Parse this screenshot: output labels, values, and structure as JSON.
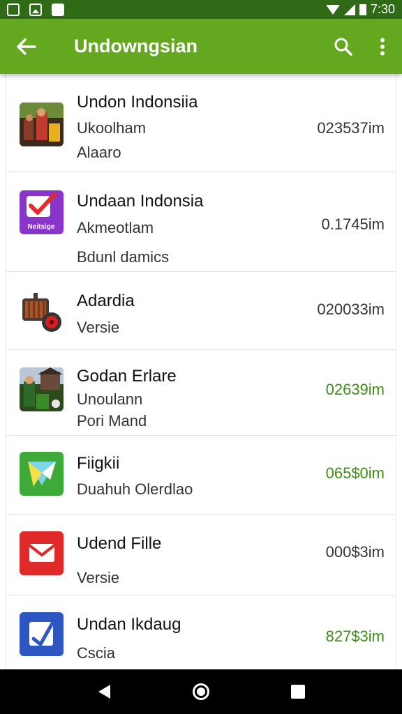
{
  "status_bar": {
    "time": "7:30",
    "left_icons": [
      "sim-icon",
      "photo-icon",
      "message-icon"
    ],
    "right_icons": [
      "wifi-icon",
      "signal-icon",
      "battery-icon"
    ]
  },
  "app_bar": {
    "title": "Undowngsian",
    "icons": [
      "back-arrow-icon",
      "search-icon",
      "more-vert-icon"
    ],
    "color": "#64a81f"
  },
  "list": {
    "items": [
      {
        "title": "Undon Indonsiia",
        "subtitle_1": "Ukoolham",
        "subtitle_2": "Alaaro",
        "size": "023537im",
        "size_color": "default",
        "icon": "app-thumbnail-photo"
      },
      {
        "title": "Undaan Indonsia",
        "subtitle_1": "Akmeotlam",
        "subtitle_2": "Bdunl damics",
        "size": "0.1745im",
        "size_color": "default",
        "icon": "app-checkmark-icon",
        "icon_text": "Neitsige"
      },
      {
        "title": "Adardia",
        "subtitle_1": "Versie",
        "subtitle_2": "",
        "size": "020033im",
        "size_color": "default",
        "icon": "app-engine-icon"
      },
      {
        "title": "Godan Erlare",
        "subtitle_1": "Unoulann",
        "subtitle_2": "Pori Mand",
        "size": "02639im",
        "size_color": "mixed",
        "icon": "app-thumbnail-photo-2"
      },
      {
        "title": "Fiigkii",
        "subtitle_1": "Duahuh Olerdlao",
        "subtitle_2": "",
        "size": "065$0im",
        "size_color": "green",
        "icon": "app-play-icon"
      },
      {
        "title": "Udend Fille",
        "subtitle_1": "Versie",
        "subtitle_2": "",
        "size": "000$3im",
        "size_color": "green",
        "icon": "app-mail-icon"
      },
      {
        "title": "Undan Ikdaug",
        "subtitle_1": "Cscia",
        "subtitle_2": "",
        "size": "827$3im",
        "size_color": "green",
        "icon": "app-tasks-icon"
      }
    ]
  },
  "nav_bar": {
    "icons": [
      "nav-back-icon",
      "nav-home-icon",
      "nav-recents-icon"
    ]
  }
}
